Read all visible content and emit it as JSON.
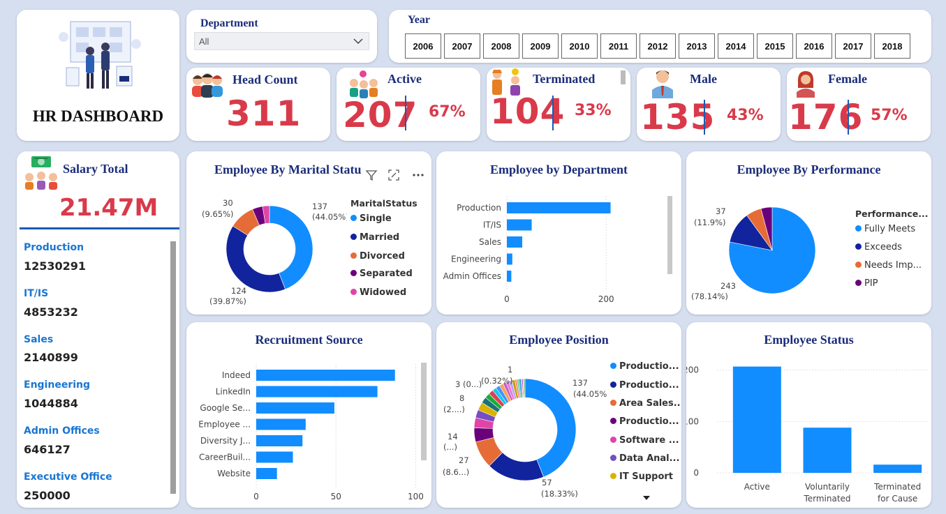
{
  "logo": {
    "title": "HR DASHBOARD"
  },
  "department_filter": {
    "label": "Department",
    "value": "All"
  },
  "year_filter": {
    "label": "Year",
    "years": [
      "2006",
      "2007",
      "2008",
      "2009",
      "2010",
      "2011",
      "2012",
      "2013",
      "2014",
      "2015",
      "2016",
      "2017",
      "2018"
    ]
  },
  "kpis": {
    "head_count": {
      "label": "Head Count",
      "value": "311"
    },
    "active": {
      "label": "Active",
      "value": "207",
      "pct": "67%"
    },
    "terminated": {
      "label": "Terminated",
      "value": "104",
      "pct": "33%"
    },
    "male": {
      "label": "Male",
      "value": "135",
      "pct": "43%"
    },
    "female": {
      "label": "Female",
      "value": "176",
      "pct": "57%"
    }
  },
  "salary": {
    "label": "Salary Total",
    "total": "21.47M",
    "items": [
      {
        "dept": "Production",
        "value": "12530291"
      },
      {
        "dept": "IT/IS",
        "value": "4853232"
      },
      {
        "dept": "Sales",
        "value": "2140899"
      },
      {
        "dept": "Engineering",
        "value": "1044884"
      },
      {
        "dept": "Admin Offices",
        "value": "646127"
      },
      {
        "dept": "Executive Office",
        "value": "250000"
      }
    ]
  },
  "colors": {
    "accent_red": "#d93a4a",
    "title_blue": "#1a2c7a",
    "bar_blue": "#118dff",
    "navy": "#12239e",
    "orange": "#e66c37",
    "purple": "#6b007b",
    "pink": "#e044a7",
    "violet": "#744ec2",
    "gold": "#d9b300"
  },
  "charts": {
    "marital": {
      "title": "Employee By Marital Status",
      "legend_title": "MaritalStatus",
      "labels": [
        {
          "text": "137",
          "pct": "(44.05%)"
        },
        {
          "text": "124",
          "pct": "(39.87%)"
        },
        {
          "text": "30",
          "pct": "(9.65%)"
        }
      ]
    },
    "department": {
      "title": "Employee by Department"
    },
    "performance": {
      "title": "Employee By Performance",
      "legend_title": "Performance...",
      "labels": [
        {
          "text": "243",
          "pct": "(78.14%)"
        },
        {
          "text": "37",
          "pct": "(11.9%)"
        }
      ]
    },
    "recruitment": {
      "title": "Recruitment Source"
    },
    "position": {
      "title": "Employee Position",
      "labels": [
        {
          "text": "137",
          "pct": "(44.05%)"
        },
        {
          "text": "57",
          "pct": "(18.33%)"
        },
        {
          "text": "27",
          "pct": "(8.6...)"
        },
        {
          "text": "14",
          "pct": "(...)"
        },
        {
          "text": "8",
          "pct": "(2....)"
        },
        {
          "text": "3 (0...)",
          "pct": ""
        },
        {
          "text": "1",
          "pct": "(0.32%)"
        }
      ]
    },
    "status": {
      "title": "Employee Status"
    }
  },
  "chart_data": [
    {
      "type": "pie",
      "title": "Employee By Marital Status",
      "legend_title": "MaritalStatus",
      "donut": true,
      "categories": [
        "Single",
        "Married",
        "Divorced",
        "Separated",
        "Widowed"
      ],
      "values": [
        137,
        124,
        30,
        12,
        8
      ],
      "colors": [
        "#118dff",
        "#12239e",
        "#e66c37",
        "#6b007b",
        "#e044a7"
      ]
    },
    {
      "type": "bar",
      "orientation": "horizontal",
      "title": "Employee by Department",
      "categories": [
        "Production",
        "IT/IS",
        "Sales",
        "Engineering",
        "Admin Offices"
      ],
      "values": [
        209,
        50,
        31,
        11,
        9
      ],
      "ticks": [
        "0",
        "200"
      ],
      "xlim": [
        0,
        280
      ]
    },
    {
      "type": "pie",
      "title": "Employee By Performance",
      "legend_title": "Performance...",
      "categories": [
        "Fully Meets",
        "Exceeds",
        "Needs Imp...",
        "PIP"
      ],
      "values": [
        243,
        37,
        18,
        13
      ],
      "colors": [
        "#118dff",
        "#12239e",
        "#e66c37",
        "#6b007b"
      ]
    },
    {
      "type": "bar",
      "orientation": "horizontal",
      "title": "Recruitment Source",
      "categories": [
        "Indeed",
        "LinkedIn",
        "Google Se...",
        "Employee ...",
        "Diversity J...",
        "CareerBuil...",
        "Website"
      ],
      "values": [
        87,
        76,
        49,
        31,
        29,
        23,
        13
      ],
      "ticks": [
        "0",
        "50",
        "100"
      ],
      "xlim": [
        0,
        102
      ]
    },
    {
      "type": "pie",
      "title": "Employee Position",
      "donut": true,
      "categories": [
        "Productio...",
        "Productio...",
        "Area Sales...",
        "Productio...",
        "Software ...",
        "Data Anal...",
        "IT Support"
      ],
      "values": [
        137,
        57,
        27,
        14,
        10,
        8,
        8,
        6,
        5,
        5,
        4,
        4,
        4,
        3,
        3,
        3,
        3,
        2,
        2,
        2,
        1,
        1,
        1,
        1
      ],
      "colors": [
        "#118dff",
        "#12239e",
        "#e66c37",
        "#6b007b",
        "#e044a7",
        "#744ec2",
        "#d9b300",
        "#197278",
        "#1aab40",
        "#d64550",
        "#15c6f4",
        "#4092ff",
        "#ffa058",
        "#be5dc9",
        "#f472d0",
        "#b5a1ff",
        "#c4a200",
        "#ff8080",
        "#6fcf97",
        "#2d9cdb",
        "#eb5757",
        "#9b51e0",
        "#f2994a",
        "#27ae60"
      ]
    },
    {
      "type": "bar",
      "title": "Employee Status",
      "categories": [
        "Active",
        "Voluntarily Terminated",
        "Terminated for Cause"
      ],
      "values": [
        207,
        88,
        16
      ],
      "ticks": [
        "0",
        "100",
        "200"
      ],
      "ylim": [
        0,
        220
      ]
    }
  ]
}
